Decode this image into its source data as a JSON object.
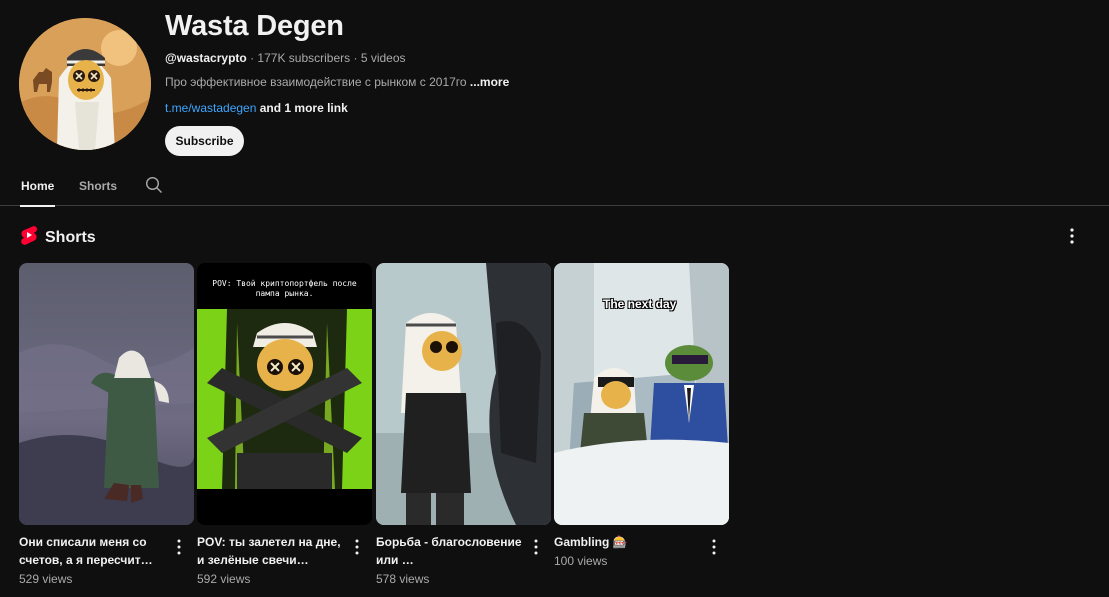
{
  "channel": {
    "name": "Wasta Degen",
    "handle": "@wastacrypto",
    "subscribers": "177K subscribers",
    "videos": "5 videos",
    "description": "Про эффективное взаимодействие с рынком с 2017го",
    "more_label": "...more",
    "link": "t.me/wastadegen",
    "more_links": "and 1 more link",
    "subscribe_label": "Subscribe"
  },
  "tabs": [
    {
      "label": "Home",
      "active": true
    },
    {
      "label": "Shorts",
      "active": false
    }
  ],
  "shorts_section": {
    "title": "Shorts",
    "items": [
      {
        "title": "Они списали меня со счетов, а я пересчит…",
        "views": "529 views"
      },
      {
        "title": "POV: ты залетел на дне, и зелёные свечи…",
        "views": "592 views",
        "overlay": "POV: Твой криптопортфель после пампа рынка."
      },
      {
        "title": "Борьба - благословение или …",
        "views": "578 views"
      },
      {
        "title": "Gambling 🎰",
        "views": "100 views",
        "overlay": "The next day"
      }
    ]
  },
  "colors": {
    "background": "#0f0f0f",
    "link": "#3ea6ff",
    "shorts_red": "#ff0033"
  }
}
